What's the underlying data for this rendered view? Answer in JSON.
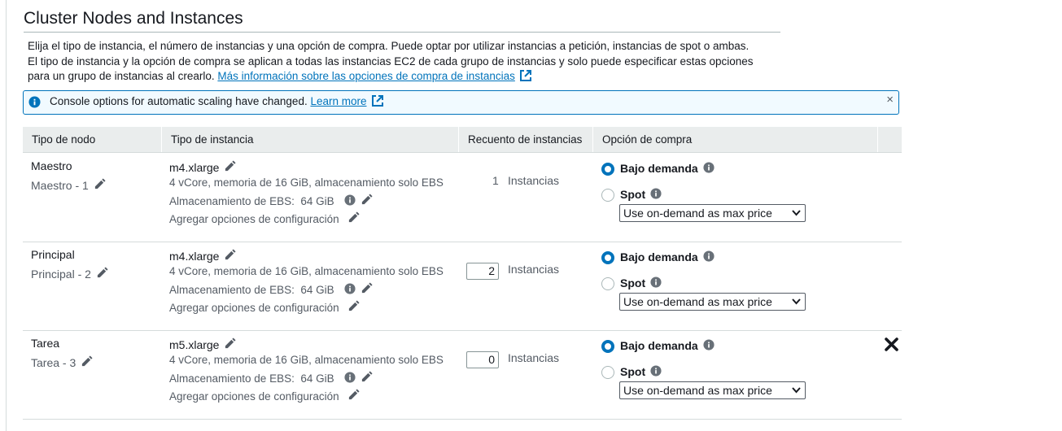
{
  "page": {
    "title": "Cluster Nodes and Instances",
    "description_line1": "Elija el tipo de instancia, el número de instancias y una opción de compra. Puede optar por utilizar instancias a petición, instancias de spot o ambas.",
    "description_line2": "El tipo de instancia y la opción de compra se aplican a todas las instancias EC2 de cada grupo de instancias y solo puede especificar estas opciones",
    "description_line3_prefix": "para un grupo de instancias al crearlo.",
    "more_info_link": "Más información sobre las opciones de compra de instancias"
  },
  "banner": {
    "text": "Console options for automatic scaling have changed.",
    "link": "Learn more",
    "close_glyph": "×"
  },
  "table": {
    "headers": [
      "Tipo de nodo",
      "Tipo de instancia",
      "Recuento de instancias",
      "Opción de compra"
    ],
    "rows": [
      {
        "node_type": "Maestro",
        "node_sub": "Maestro - 1",
        "instance_type": "m4.xlarge",
        "spec": "4 vCore, memoria de 16 GiB, almacenamiento solo EBS",
        "ebs_label": "Almacenamiento de EBS:",
        "ebs_value": "64 GiB",
        "config": "Agregar opciones de configuración",
        "count": "1",
        "count_unit": "Instancias",
        "on_demand_label": "Bajo demanda",
        "spot_label": "Spot",
        "price_select": "Use on-demand as max price",
        "selected": "Bajo demanda"
      },
      {
        "node_type": "Principal",
        "node_sub": "Principal - 2",
        "instance_type": "m4.xlarge",
        "spec": "4 vCore, memoria de 16 GiB, almacenamiento solo EBS",
        "ebs_label": "Almacenamiento de EBS:",
        "ebs_value": "64 GiB",
        "config": "Agregar opciones de configuración",
        "count": "2",
        "count_unit": "Instancias",
        "on_demand_label": "Bajo demanda",
        "spot_label": "Spot",
        "price_select": "Use on-demand as max price",
        "selected": "Bajo demanda"
      },
      {
        "node_type": "Tarea",
        "node_sub": "Tarea - 3",
        "instance_type": "m5.xlarge",
        "spec": "4 vCore, memoria de 16 GiB, almacenamiento solo EBS",
        "ebs_label": "Almacenamiento de EBS:",
        "ebs_value": "64 GiB",
        "config": "Agregar opciones de configuración",
        "count": "0",
        "count_unit": "Instancias",
        "on_demand_label": "Bajo demanda",
        "spot_label": "Spot",
        "price_select": "Use on-demand as max price",
        "selected": "Bajo demanda"
      }
    ]
  },
  "colors": {
    "accent": "#0073bb",
    "text": "#16191f",
    "muted": "#545b64",
    "header_bg": "#eaeded",
    "banner_bg": "#f1faff"
  },
  "icons": [
    "pencil-icon",
    "info-icon",
    "external-link-icon",
    "close-icon",
    "remove-icon",
    "chevron-down-icon"
  ]
}
